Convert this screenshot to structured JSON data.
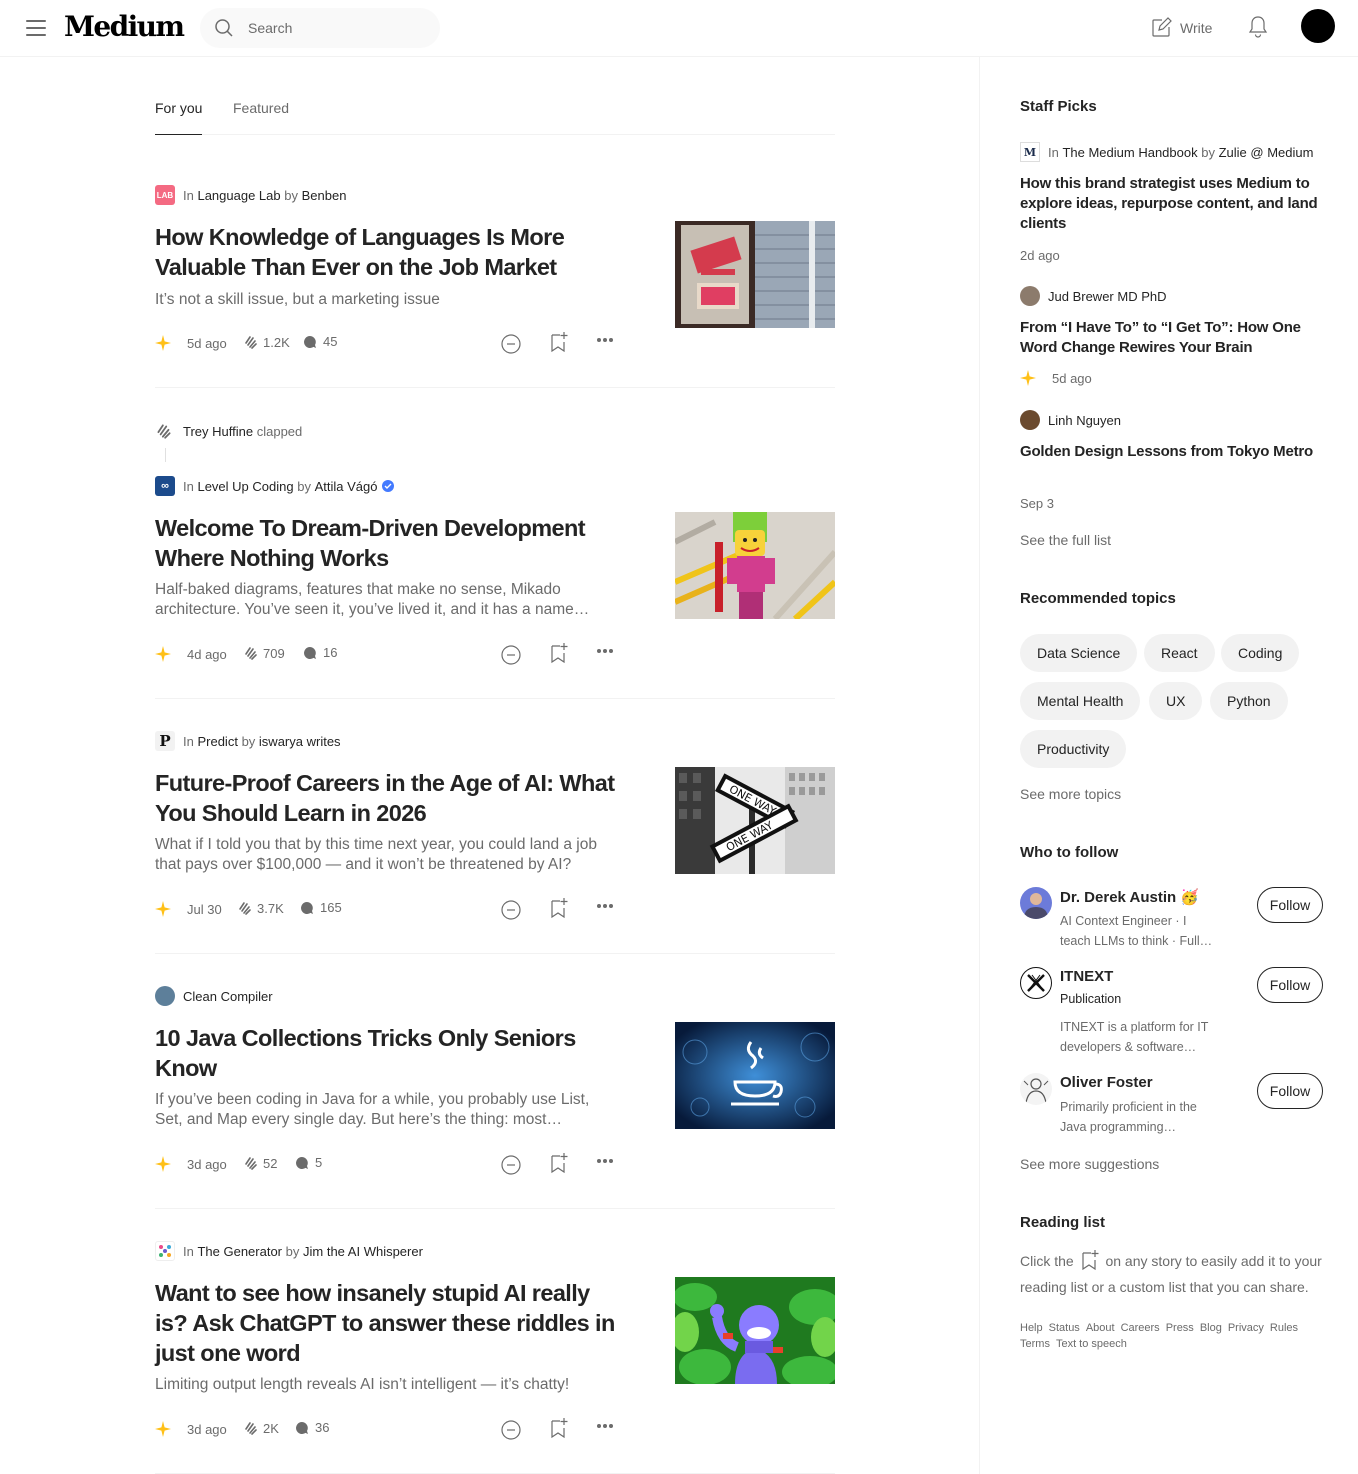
{
  "header": {
    "logo": "Medium",
    "search_placeholder": "Search",
    "write_label": "Write"
  },
  "tabs": [
    {
      "label": "For you",
      "active": true
    },
    {
      "label": "Featured",
      "active": false
    }
  ],
  "articles": [
    {
      "in_label": "In",
      "publication": "Language Lab",
      "by_label": "by",
      "author": "Benben",
      "title": "How Knowledge of Languages Is More Valuable Than Ever on the Job Market",
      "subtitle": "It’s not a skill issue, but a marketing issue",
      "date": "5d ago",
      "claps": "1.2K",
      "responses": "45"
    },
    {
      "clapped_by": "Trey Huffine",
      "clapped_label": "clapped",
      "in_label": "In",
      "publication": "Level Up Coding",
      "by_label": "by",
      "author": "Attila Vágó",
      "title": "Welcome To Dream-Driven Development Where Nothing Works",
      "subtitle": "Half-baked diagrams, features that make no sense, Mikado architecture. You’ve seen it, you’ve lived it, and it has a name…",
      "date": "4d ago",
      "claps": "709",
      "responses": "16"
    },
    {
      "in_label": "In",
      "publication": "Predict",
      "by_label": "by",
      "author": "iswarya writes",
      "title": "Future-Proof Careers in the Age of AI: What You Should Learn in 2026",
      "subtitle": "What if I told you that by this time next year, you could land a job that pays over $100,000 — and it won’t be threatened by AI?",
      "date": "Jul 30",
      "claps": "3.7K",
      "responses": "165"
    },
    {
      "author": "Clean Compiler",
      "title": "10 Java Collections Tricks Only Seniors Know",
      "subtitle": "If you’ve been coding in Java for a while, you probably use List, Set, and Map every single day. But here’s the thing: most…",
      "date": "3d ago",
      "claps": "52",
      "responses": "5"
    },
    {
      "in_label": "In",
      "publication": "The Generator",
      "by_label": "by",
      "author": "Jim the AI Whisperer",
      "title": "Want to see how insanely stupid AI really is? Ask ChatGPT to answer these riddles in just one word",
      "subtitle": "Limiting output length reveals AI isn’t intelligent — it’s chatty!",
      "date": "3d ago",
      "claps": "2K",
      "responses": "36"
    }
  ],
  "sidebar": {
    "staff_picks": {
      "heading": "Staff Picks",
      "items": [
        {
          "in_label": "In",
          "publication": "The Medium Handbook",
          "by_label": "by",
          "author": "Zulie @ Medium",
          "title": "How this brand strategist uses Medium to explore ideas, repurpose content, and land clients",
          "date": "2d ago"
        },
        {
          "author": "Jud Brewer MD PhD",
          "title": "From “I Have To” to “I Get To”: How One Word Change Rewires Your Brain",
          "date": "5d ago"
        },
        {
          "author": "Linh Nguyen",
          "title": "Golden Design Lessons from Tokyo Metro",
          "date": "Sep 3"
        }
      ],
      "see_full": "See the full list"
    },
    "topics": {
      "heading": "Recommended topics",
      "chips": [
        "Data Science",
        "React",
        "Coding",
        "Mental Health",
        "UX",
        "Python",
        "Productivity"
      ],
      "see_more": "See more topics"
    },
    "follow": {
      "heading": "Who to follow",
      "items": [
        {
          "name": "Dr. Derek Austin 🥳",
          "desc": "AI Context Engineer · I teach LLMs to think · Full…",
          "button": "Follow"
        },
        {
          "name": "ITNEXT",
          "kind": "Publication",
          "desc": "ITNEXT is a platform for IT developers & software…",
          "button": "Follow"
        },
        {
          "name": "Oliver Foster",
          "desc": "Primarily proficient in the Java programming…",
          "button": "Follow"
        }
      ],
      "see_more": "See more suggestions"
    },
    "reading_list": {
      "heading": "Reading list",
      "text_before": "Click the",
      "text_after": "on any story to easily add it to your reading list or a custom list that you can share."
    },
    "footer": [
      "Help",
      "Status",
      "About",
      "Careers",
      "Press",
      "Blog",
      "Privacy",
      "Rules",
      "Terms",
      "Text to speech"
    ]
  }
}
